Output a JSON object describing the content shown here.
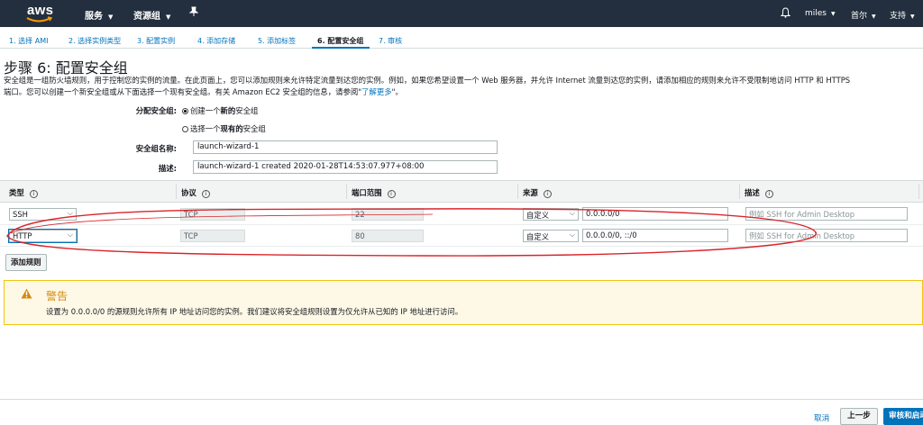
{
  "topnav": {
    "logo_text": "aws",
    "services": "服务",
    "resource_groups": "资源组",
    "user": "miles",
    "region": "首尔",
    "support": "支持"
  },
  "wizard": {
    "tabs": [
      "1. 选择 AMI",
      "2. 选择实例类型",
      "3. 配置实例",
      "4. 添加存储",
      "5. 添加标签",
      "6. 配置安全组",
      "7. 审核"
    ],
    "active_index": 5
  },
  "page": {
    "title": "步骤 6: 配置安全组",
    "description_1": "安全组是一组防火墙规则，用于控制您的实例的流量。在此页面上，您可以添加规则来允许特定流量到达您的实例。例如，如果您希望设置一个 Web 服务器，并允许 Internet 流量到达您的实例，请添加相应的规则来允许不受限制地访问 HTTP 和 HTTPS",
    "description_2": "端口。您可以创建一个新安全组或从下面选择一个现有安全组。有关 Amazon EC2 安全组的信息，请参阅",
    "learn_more": "了解更多",
    "description_end": "。"
  },
  "form": {
    "assign_label": "分配安全组:",
    "option_new_pre": "创建一个",
    "option_new_bold": "新的",
    "option_new_post": "安全组",
    "option_existing_pre": "选择一个",
    "option_existing_bold": "现有的",
    "option_existing_post": "安全组",
    "name_label": "安全组名称:",
    "name_value": "launch-wizard-1",
    "desc_label": "描述:",
    "desc_value": "launch-wizard-1 created 2020-01-28T14:53:07.977+08:00"
  },
  "table": {
    "headers": [
      "类型",
      "协议",
      "端口范围",
      "来源",
      "描述"
    ],
    "rows": [
      {
        "type": "SSH",
        "protocol": "TCP",
        "port": "22",
        "source_type": "自定义",
        "source": "0.0.0.0/0",
        "description_placeholder": "例如 SSH for Admin Desktop"
      },
      {
        "type": "HTTP",
        "protocol": "TCP",
        "port": "80",
        "source_type": "自定义",
        "source": "0.0.0.0/0, ::/0",
        "description_placeholder": "例如 SSH for Admin Desktop"
      }
    ]
  },
  "add_rule": "添加规则",
  "warning": {
    "title": "警告",
    "text": "设置为 0.0.0.0/0 的源规则允许所有 IP 地址访问您的实例。我们建议将安全组规则设置为仅允许从已知的 IP 地址进行访问。"
  },
  "footer": {
    "cancel": "取消",
    "previous": "上一步",
    "review": "审核和启动"
  },
  "colors": {
    "nav_bg": "#232f3e",
    "link": "#0073bb",
    "warning_border": "#f1c40f",
    "annotation_red": "#d9252b"
  }
}
